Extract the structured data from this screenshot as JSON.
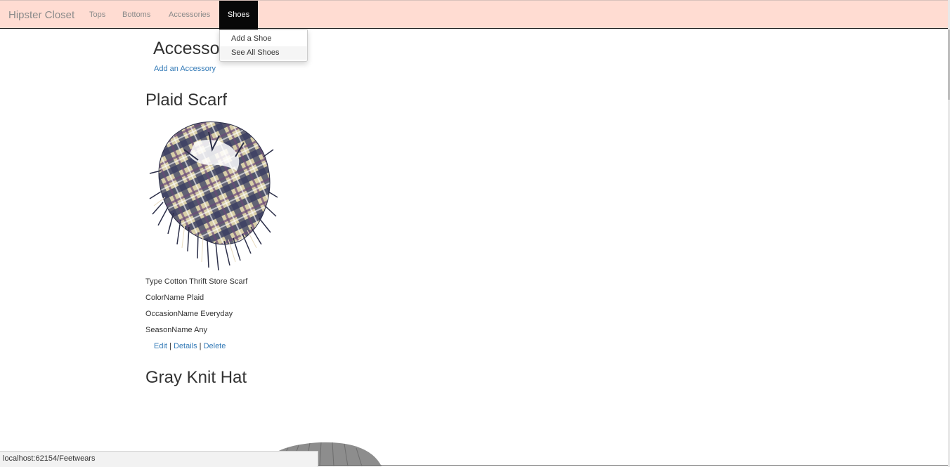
{
  "navbar": {
    "brand": "Hipster Closet",
    "links": [
      "Tops",
      "Bottoms",
      "Accessories"
    ],
    "active": "Shoes",
    "dropdown": [
      "Add a Shoe",
      "See All Shoes"
    ]
  },
  "page": {
    "heading": "Accessories",
    "add_link": "Add an Accessory"
  },
  "items": [
    {
      "title": "Plaid Scarf",
      "properties": [
        "Type Cotton Thrift Store Scarf",
        "ColorName Plaid",
        "OccasionName Everyday",
        "SeasonName Any"
      ],
      "actions": [
        "Edit",
        "Details",
        "Delete"
      ]
    },
    {
      "title": "Gray Knit Hat"
    }
  ],
  "status_bar": "localhost:62154/Feetwears",
  "colors": {
    "navbar_bg": "#ffdcd2",
    "active_tab_bg": "#080808",
    "link": "#337ab7"
  }
}
